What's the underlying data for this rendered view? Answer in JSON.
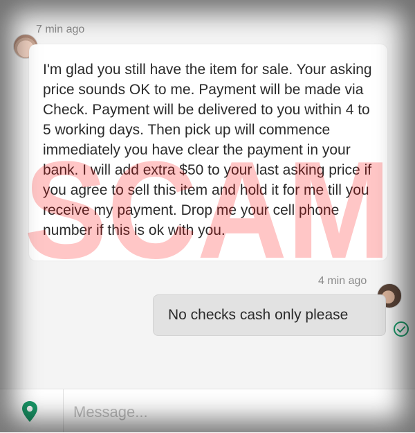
{
  "conversation": {
    "incoming": {
      "time": "7 min ago",
      "text": "I'm glad you still have the item for sale. Your asking price sounds OK to me. Payment will be made via Check. Payment will be delivered to you within 4 to 5 working days. Then pick up will commence immediately you have clear the payment in your bank. I will add extra $50 to your last asking price if you agree to sell this item and hold it for me till you receive my payment. Drop me your cell phone number if this is ok with you."
    },
    "outgoing": {
      "time": "4 min ago",
      "text": "No checks cash only please",
      "status_icon": "check-circle-icon"
    }
  },
  "watermark": {
    "text": "SCAM",
    "color": "#ff0000"
  },
  "composer": {
    "placeholder": "Message...",
    "location_icon": "location-pin-icon",
    "accent_color": "#1a9b6a"
  }
}
